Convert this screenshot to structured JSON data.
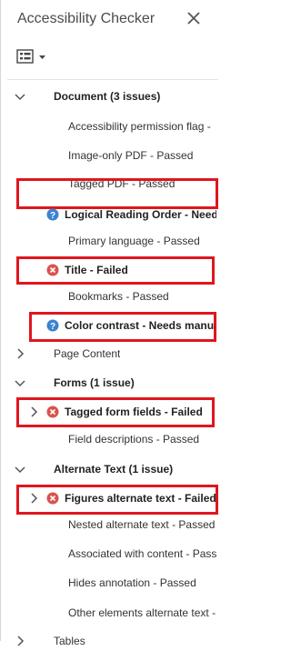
{
  "panel": {
    "title": "Accessibility Checker"
  },
  "rows": {
    "document": "Document (3 issues)",
    "access_perm": "Accessibility permission flag -",
    "image_only": "Image-only PDF - Passed",
    "tagged_pdf": "Tagged PDF - Passed",
    "logical": "Logical Reading Order - Needs",
    "primary_lang": "Primary language - Passed",
    "title": "Title - Failed",
    "bookmarks": "Bookmarks - Passed",
    "color_contrast": "Color contrast - Needs manua",
    "page_content": "Page Content",
    "forms": "Forms (1 issue)",
    "tagged_form": "Tagged form fields - Failed",
    "field_desc": "Field descriptions - Passed",
    "alt_text": "Alternate Text (1 issue)",
    "figures_alt": "Figures alternate text - Failed",
    "nested_alt": "Nested alternate text - Passed",
    "associated": "Associated with content - Pass",
    "hides_ann": "Hides annotation - Passed",
    "other_alt": "Other elements alternate text -",
    "tables": "Tables"
  },
  "colors": {
    "highlight": "#e0161e",
    "fail": "#d9534f",
    "needs_check": "#3b82d1"
  },
  "icons": {
    "close": "close-icon",
    "options": "options-list-icon",
    "expanded": "chevron-down-icon",
    "collapsed": "chevron-right-icon",
    "failed": "failed-icon",
    "needs_check": "question-icon"
  }
}
